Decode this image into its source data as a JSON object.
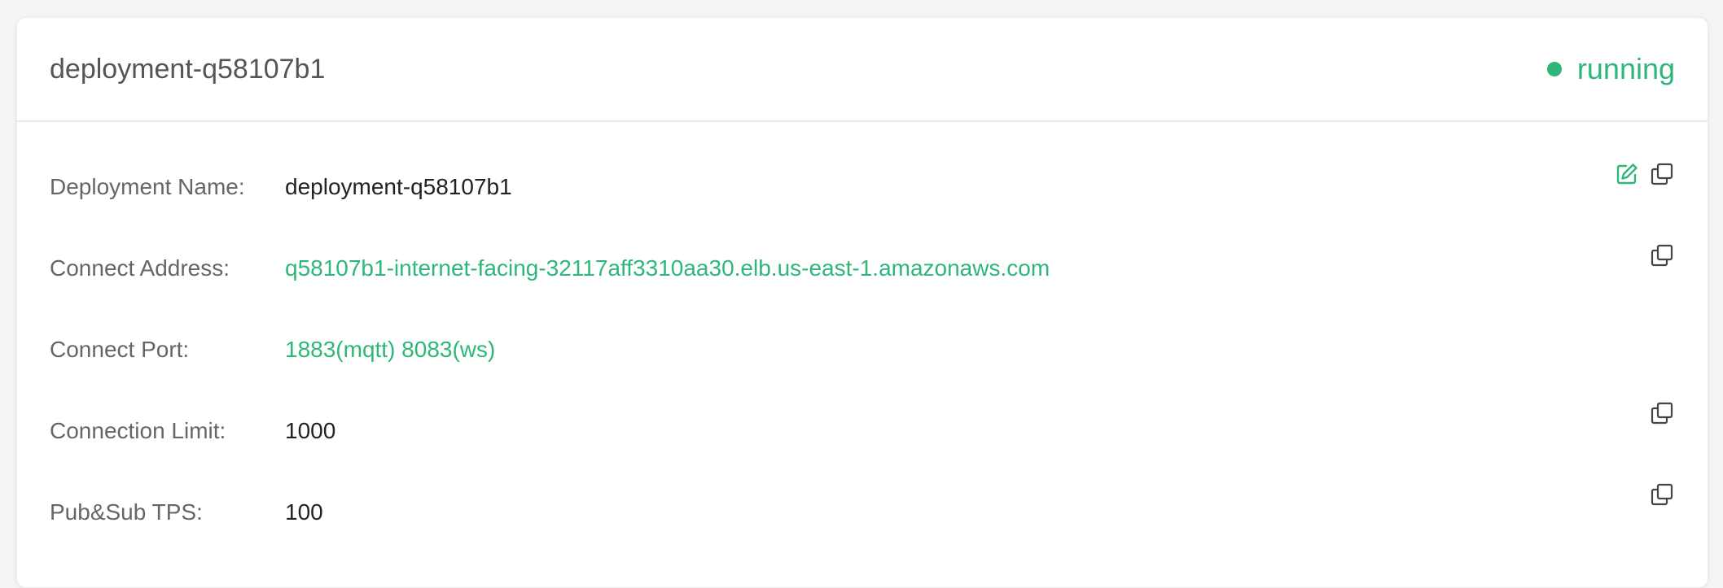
{
  "header": {
    "title": "deployment-q58107b1",
    "status_text": "running",
    "status_color": "#2fb77a"
  },
  "details": [
    {
      "label": "Deployment Name:",
      "value": "deployment-q58107b1",
      "value_style": "plain",
      "actions": [
        "edit-icon",
        "copy-icon"
      ]
    },
    {
      "label": "Connect Address:",
      "value": "q58107b1-internet-facing-32117aff3310aa30.elb.us-east-1.amazonaws.com",
      "value_style": "accent",
      "actions": [
        "copy-icon"
      ]
    },
    {
      "label": "Connect Port:",
      "value": "1883(mqtt) 8083(ws)",
      "value_style": "accent",
      "actions": []
    },
    {
      "label": "Connection Limit:",
      "value": "1000",
      "value_style": "plain",
      "actions": [
        "copy-icon"
      ]
    },
    {
      "label": "Pub&Sub TPS:",
      "value": "100",
      "value_style": "plain",
      "actions": [
        "copy-icon"
      ]
    }
  ],
  "colors": {
    "accent": "#2fb77a",
    "label": "#666666",
    "value": "#222222",
    "icon": "#444444"
  }
}
